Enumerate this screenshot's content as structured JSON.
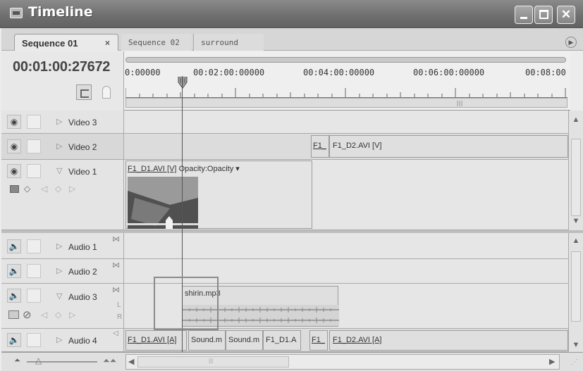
{
  "window": {
    "title": "Timeline"
  },
  "tabs": [
    {
      "label": "Sequence 01",
      "active": true
    },
    {
      "label": "Sequence 02",
      "active": false
    },
    {
      "label": "surround",
      "active": false
    }
  ],
  "tab_close_glyph": "×",
  "timecode": "00:01:00:27672",
  "ruler_labels": [
    "0:00000",
    "00:02:00:00000",
    "00:04:00:00000",
    "00:06:00:00000",
    "00:08:00"
  ],
  "video_tracks": [
    {
      "label": "Video 3",
      "expanded": false
    },
    {
      "label": "Video 2",
      "expanded": false
    },
    {
      "label": "Video 1",
      "expanded": true
    }
  ],
  "audio_tracks": [
    {
      "label": "Audio 1",
      "expanded": false
    },
    {
      "label": "Audio 2",
      "expanded": false
    },
    {
      "label": "Audio 3",
      "expanded": true
    },
    {
      "label": "Audio 4",
      "expanded": false
    }
  ],
  "clips": {
    "video2": [
      "F1_",
      "F1_D2.AVI [V]"
    ],
    "video1": {
      "name": "F1_D1.AVI [V]",
      "effect": "Opacity:Opacity ▾"
    },
    "audio3": {
      "name": "shirin.mp3"
    },
    "audio4": [
      "F1_D1.AVI [A]",
      "Sound.m",
      "Sound.m",
      "F1_D1.A",
      "F1_",
      "F1_D2.AVI [A]"
    ]
  },
  "audio_channel_labels": [
    "L",
    "R"
  ],
  "icons": {
    "eye": "eye-icon",
    "speaker": "speaker-icon",
    "expand": "triangle-icon"
  },
  "colors": {
    "titlebar": "#6e6e6e",
    "panel": "#e6e6e6",
    "selection_box": "#8a8a8a"
  }
}
